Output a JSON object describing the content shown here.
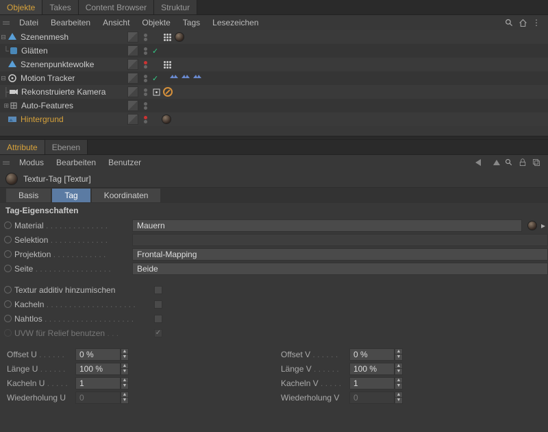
{
  "topTabs": {
    "objects": "Objekte",
    "takes": "Takes",
    "contentBrowser": "Content Browser",
    "struktur": "Struktur"
  },
  "menu1": {
    "datei": "Datei",
    "bearbeiten": "Bearbeiten",
    "ansicht": "Ansicht",
    "objekte": "Objekte",
    "tags": "Tags",
    "lesezeichen": "Lesezeichen"
  },
  "tree": {
    "szenenmesh": "Szenenmesh",
    "glaetten": "Glätten",
    "szenenpunktewolke": "Szenenpunktewolke",
    "motionTracker": "Motion Tracker",
    "rekonKamera": "Rekonstruierte Kamera",
    "autoFeatures": "Auto-Features",
    "hintergrund": "Hintergrund"
  },
  "attrTabs": {
    "attribute": "Attribute",
    "ebenen": "Ebenen"
  },
  "menu2": {
    "modus": "Modus",
    "bearbeiten": "Bearbeiten",
    "benutzer": "Benutzer"
  },
  "attrTitle": "Textur-Tag [Textur]",
  "subTabs": {
    "basis": "Basis",
    "tag": "Tag",
    "koord": "Koordinaten"
  },
  "sectionTitle": "Tag-Eigenschaften",
  "props": {
    "material": {
      "label": "Material",
      "value": "Mauern"
    },
    "selektion": {
      "label": "Selektion",
      "value": ""
    },
    "projektion": {
      "label": "Projektion",
      "value": "Frontal-Mapping"
    },
    "seite": {
      "label": "Seite",
      "value": "Beide"
    },
    "texturAdd": {
      "label": "Textur additiv hinzumischen"
    },
    "kacheln": {
      "label": "Kacheln"
    },
    "nahtlos": {
      "label": "Nahtlos"
    },
    "uvwRelief": {
      "label": "UVW für Relief benutzen"
    },
    "offsetU": {
      "label": "Offset U",
      "value": "0 %"
    },
    "offsetV": {
      "label": "Offset V",
      "value": "0 %"
    },
    "laengeU": {
      "label": "Länge U",
      "value": "100 %"
    },
    "laengeV": {
      "label": "Länge V",
      "value": "100 %"
    },
    "kachelnU": {
      "label": "Kacheln U",
      "value": "1"
    },
    "kachelnV": {
      "label": "Kacheln V",
      "value": "1"
    },
    "wiederU": {
      "label": "Wiederholung U",
      "value": "0"
    },
    "wiederV": {
      "label": "Wiederholung V",
      "value": "0"
    }
  }
}
